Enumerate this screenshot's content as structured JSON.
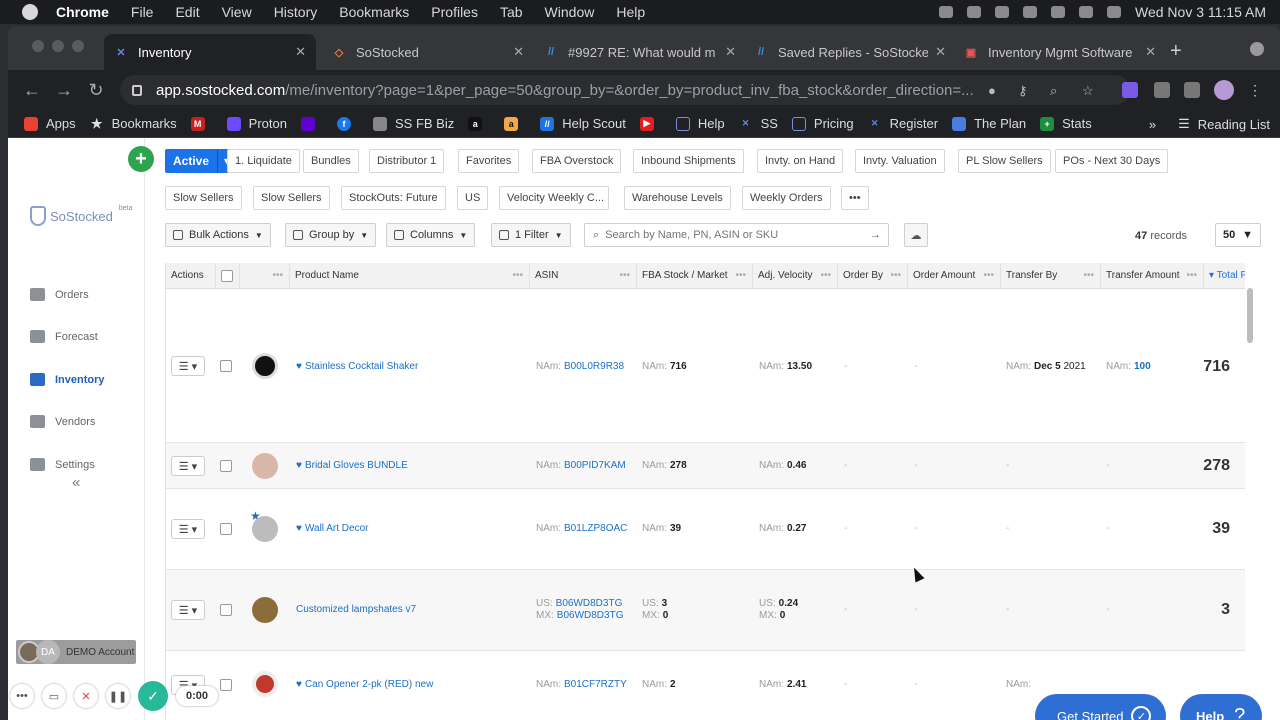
{
  "mac_menu": {
    "app": "Chrome",
    "items": [
      "File",
      "Edit",
      "View",
      "History",
      "Bookmarks",
      "Profiles",
      "Tab",
      "Window",
      "Help"
    ],
    "clock": "Wed Nov 3  11:15 AM"
  },
  "tabs": [
    {
      "title": "Inventory",
      "active": true
    },
    {
      "title": "SoStocked",
      "active": false
    },
    {
      "title": "#9927 RE: What would m",
      "active": false
    },
    {
      "title": "Saved Replies - SoStocke",
      "active": false
    },
    {
      "title": "Inventory Mgmt Software",
      "active": false
    }
  ],
  "url": {
    "host": "app.sostocked.com",
    "path": "/me/inventory?page=1&per_page=50&group_by=&order_by=product_inv_fba_stock&order_direction=..."
  },
  "bookmarks": [
    "Apps",
    "Bookmarks",
    "Proton",
    "",
    "SS FB Biz",
    "",
    "",
    "Help Scout",
    "",
    "Help",
    "SS",
    "Pricing",
    "Register",
    "The Plan",
    "Stats"
  ],
  "reading_list": "Reading List",
  "brand": {
    "name": "SoStocked",
    "badge": "beta"
  },
  "nav": [
    {
      "label": "Orders",
      "icon": "orders-icon",
      "active": false
    },
    {
      "label": "Forecast",
      "icon": "forecast-icon",
      "active": false
    },
    {
      "label": "Inventory",
      "icon": "inventory-icon",
      "active": true
    },
    {
      "label": "Vendors",
      "icon": "vendors-icon",
      "active": false
    },
    {
      "label": "Settings",
      "icon": "settings-icon",
      "active": false
    }
  ],
  "collapse_label": "«",
  "user": {
    "initials": "DA",
    "name": "DEMO Account"
  },
  "views": {
    "active_label": "Active",
    "add_label": "+",
    "more_label": "•••",
    "chips_row1": [
      "1. Liquidate",
      "Bundles",
      "Distributor 1",
      "Favorites",
      "FBA Overstock",
      "Inbound Shipments",
      "Invty. on Hand",
      "Invty. Valuation",
      "PL Slow Sellers",
      "POs - Next 30 Days"
    ],
    "chips_row2": [
      "Slow Sellers",
      "Slow Sellers",
      "StockOuts: Future",
      "US",
      "Velocity Weekly C...",
      "Warehouse Levels",
      "Weekly Orders"
    ]
  },
  "controls": {
    "bulk": "Bulk Actions",
    "group": "Group by",
    "columns": "Columns",
    "filter": "1 Filter",
    "search_placeholder": "Search by Name, PN, ASIN or SKU",
    "records_count": "47",
    "records_label": "records",
    "per_page": "50"
  },
  "columns": [
    "Actions",
    "",
    "Product Name",
    "ASIN",
    "FBA Stock / Market",
    "Adj. Velocity",
    "Order By",
    "Order Amount",
    "Transfer By",
    "Transfer Amount",
    "Total F"
  ],
  "rows": [
    {
      "name": "Stainless Cocktail Shaker",
      "fav": true,
      "asin_prefix": "NAm:",
      "asin": "B00L0R9R38",
      "stock_prefix": "NAm:",
      "stock": "716",
      "vel_prefix": "NAm:",
      "vel": "13.50",
      "order_by": "-",
      "order_amt": "-",
      "transfer_prefix": "NAm:",
      "transfer_by": "Dec 5",
      "transfer_year": "2021",
      "tamt_prefix": "NAm:",
      "transfer_amt": "100",
      "total": "716"
    },
    {
      "name": "Bridal Gloves BUNDLE",
      "fav": true,
      "asin_prefix": "NAm:",
      "asin": "B00PID7KAM",
      "stock_prefix": "NAm:",
      "stock": "278",
      "vel_prefix": "NAm:",
      "vel": "0.46",
      "order_by": "-",
      "order_amt": "-",
      "transfer_by": "-",
      "transfer_amt": "-",
      "total": "278"
    },
    {
      "name": "Wall Art Decor",
      "fav": true,
      "asin_prefix": "NAm:",
      "asin": "B01LZP8OAC",
      "stock_prefix": "NAm:",
      "stock": "39",
      "vel_prefix": "NAm:",
      "vel": "0.27",
      "order_by": "-",
      "order_amt": "-",
      "transfer_by": "-",
      "transfer_amt": "-",
      "total": "39"
    },
    {
      "name": "Customized lampshates v7",
      "fav": false,
      "asin_prefix": "US:",
      "asin": "B06WD8D3TG",
      "asin_prefix2": "MX:",
      "asin2": "B06WD8D3TG",
      "stock_prefix": "US:",
      "stock": "3",
      "stock_prefix2": "MX:",
      "stock2": "0",
      "vel_prefix": "US:",
      "vel": "0.24",
      "vel_prefix2": "MX:",
      "vel2": "0",
      "order_by": "-",
      "order_amt": "-",
      "transfer_by": "-",
      "transfer_amt": "-",
      "total": "3"
    },
    {
      "name": "Can Opener 2-pk (RED) new",
      "fav": true,
      "asin_prefix": "NAm:",
      "asin": "B01CF7RZTY",
      "stock_prefix": "NAm:",
      "stock": "2",
      "vel_prefix": "NAm:",
      "vel": "2.41",
      "order_by": "-",
      "order_amt": "-",
      "transfer_prefix": "NAm:",
      "transfer_by": "",
      "total": ""
    }
  ],
  "widgets": {
    "get_started": "Get Started",
    "help": "Help",
    "help_icon": "?",
    "timer": "0:00"
  }
}
